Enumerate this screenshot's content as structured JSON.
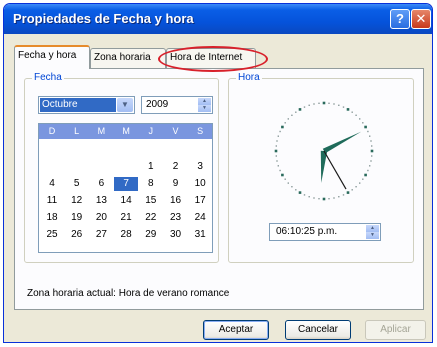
{
  "window": {
    "title": "Propiedades de Fecha y hora",
    "help_glyph": "?",
    "close_glyph": "✕"
  },
  "tabs": [
    {
      "label": "Fecha y hora",
      "active": true
    },
    {
      "label": "Zona horaria",
      "active": false
    },
    {
      "label": "Hora de Internet",
      "active": false,
      "highlighted": true
    }
  ],
  "fecha": {
    "legend": "Fecha",
    "month": "Octubre",
    "year": "2009",
    "day_headers": [
      "D",
      "L",
      "M",
      "M",
      "J",
      "V",
      "S"
    ],
    "selected_day": "7",
    "weeks": [
      [
        "",
        "",
        "",
        "",
        "1",
        "2",
        "3"
      ],
      [
        "4",
        "5",
        "6",
        "7",
        "8",
        "9",
        "10"
      ],
      [
        "11",
        "12",
        "13",
        "14",
        "15",
        "16",
        "17"
      ],
      [
        "18",
        "19",
        "20",
        "21",
        "22",
        "23",
        "24"
      ],
      [
        "25",
        "26",
        "27",
        "28",
        "29",
        "30",
        "31"
      ]
    ]
  },
  "hora": {
    "legend": "Hora",
    "time": "06:10:25 p.m."
  },
  "timezone_text": "Zona horaria actual: Hora de verano romance",
  "buttons": {
    "ok": "Aceptar",
    "cancel": "Cancelar",
    "apply": "Aplicar"
  },
  "colors": {
    "titlebar": "#0553db",
    "selection": "#316ac5",
    "highlight_ring": "#d8212b",
    "clock_hands": "#1f6b5a"
  },
  "icons": {
    "dropdown": "chevron-down-icon",
    "spin_up": "spin-up-icon",
    "spin_down": "spin-down-icon"
  }
}
